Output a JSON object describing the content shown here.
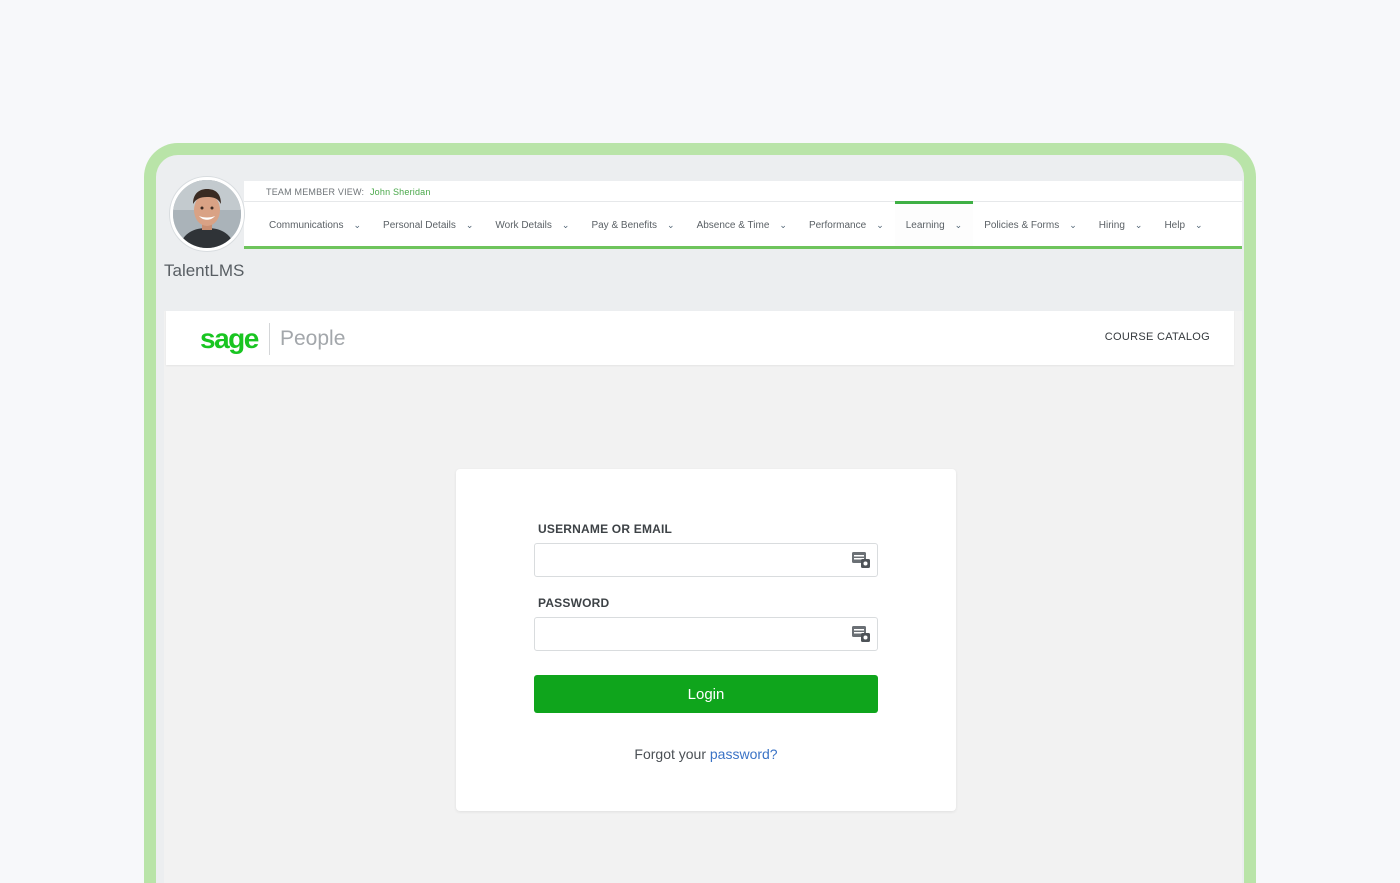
{
  "team_member_view": {
    "label": "TEAM MEMBER VIEW:",
    "name": "John Sheridan"
  },
  "nav": {
    "items": [
      {
        "label": "Communications",
        "active": false
      },
      {
        "label": "Personal Details",
        "active": false
      },
      {
        "label": "Work Details",
        "active": false
      },
      {
        "label": "Pay & Benefits",
        "active": false
      },
      {
        "label": "Absence & Time",
        "active": false
      },
      {
        "label": "Performance",
        "active": false
      },
      {
        "label": "Learning",
        "active": true
      },
      {
        "label": "Policies & Forms",
        "active": false
      },
      {
        "label": "Hiring",
        "active": false
      },
      {
        "label": "Help",
        "active": false
      }
    ],
    "chevron": "chevron-down-icon"
  },
  "app_title": "TalentLMS",
  "header": {
    "brand": "sage",
    "brand_product": "People",
    "course_catalog": "COURSE CATALOG"
  },
  "login": {
    "username_label": "USERNAME OR EMAIL",
    "username_value": "",
    "password_label": "PASSWORD",
    "password_value": "",
    "button_label": "Login",
    "forgot_prefix": "Forgot your",
    "forgot_link": "password?",
    "field_icon": "keychain-icon"
  },
  "colors": {
    "accent_green": "#0fa51c",
    "brand_green": "#19c521",
    "frame_green": "#b9e4a8",
    "link_blue": "#3a73c6"
  }
}
